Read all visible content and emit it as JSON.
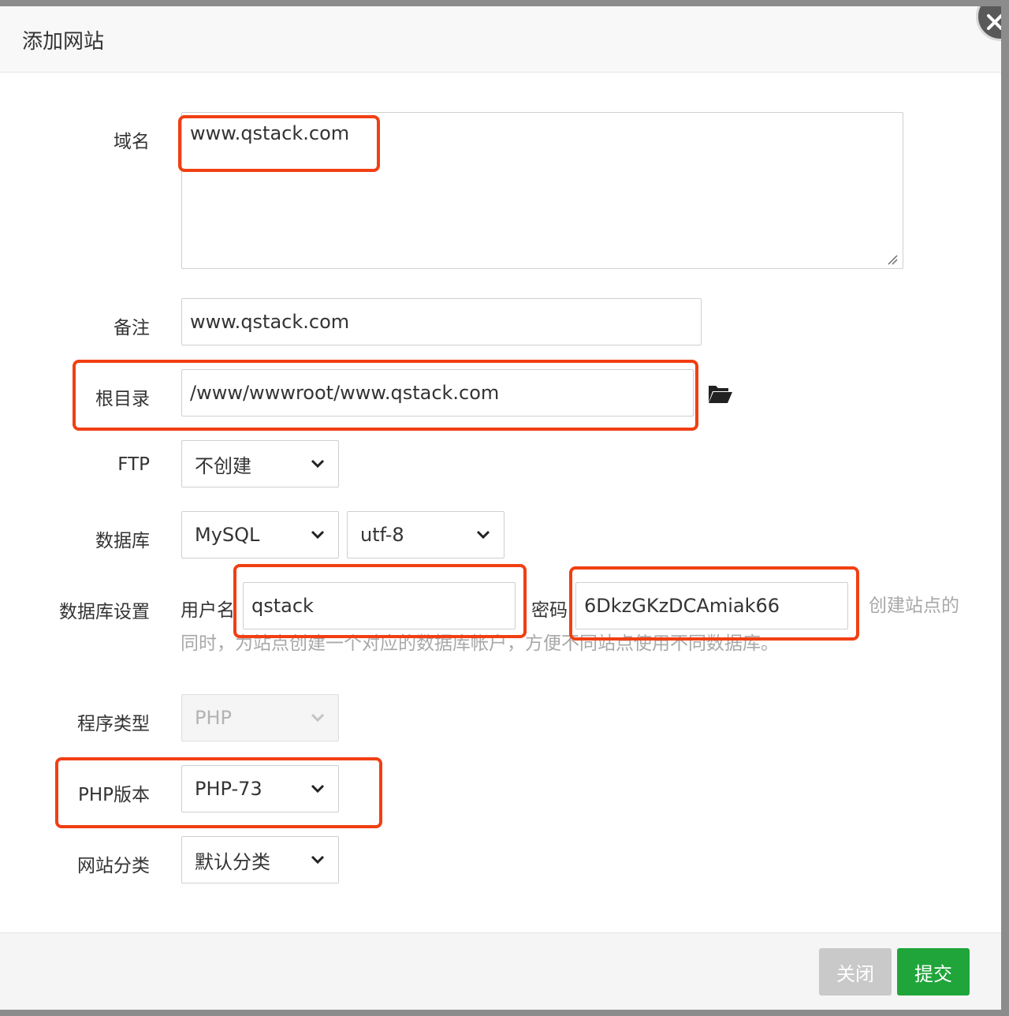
{
  "dialog": {
    "title": "添加网站"
  },
  "form": {
    "domain": {
      "label": "域名",
      "value": "www.qstack.com"
    },
    "remark": {
      "label": "备注",
      "value": "www.qstack.com"
    },
    "root_dir": {
      "label": "根目录",
      "value": "/www/wwwroot/www.qstack.com"
    },
    "ftp": {
      "label": "FTP",
      "selected": "不创建"
    },
    "database": {
      "label": "数据库",
      "type_selected": "MySQL",
      "charset_selected": "utf-8"
    },
    "db_settings": {
      "label": "数据库设置",
      "username_label": "用户名",
      "username_value": "qstack",
      "password_label": "密码",
      "password_value": "6DkzGKzDCAmiak66",
      "hint_line1": "创建站点的",
      "hint_line2": "同时，为站点创建一个对应的数据库帐户，方便不同站点使用不同数据库。"
    },
    "program_type": {
      "label": "程序类型",
      "selected": "PHP"
    },
    "php_version": {
      "label": "PHP版本",
      "selected": "PHP-73"
    },
    "site_category": {
      "label": "网站分类",
      "selected": "默认分类"
    }
  },
  "footer": {
    "close_label": "关闭",
    "submit_label": "提交"
  },
  "colors": {
    "submit": "#20a53a",
    "highlight": "#f13f13"
  },
  "icons": [
    "close-icon",
    "folder-open-icon",
    "chevron-down-icon",
    "resize-grip-icon"
  ]
}
